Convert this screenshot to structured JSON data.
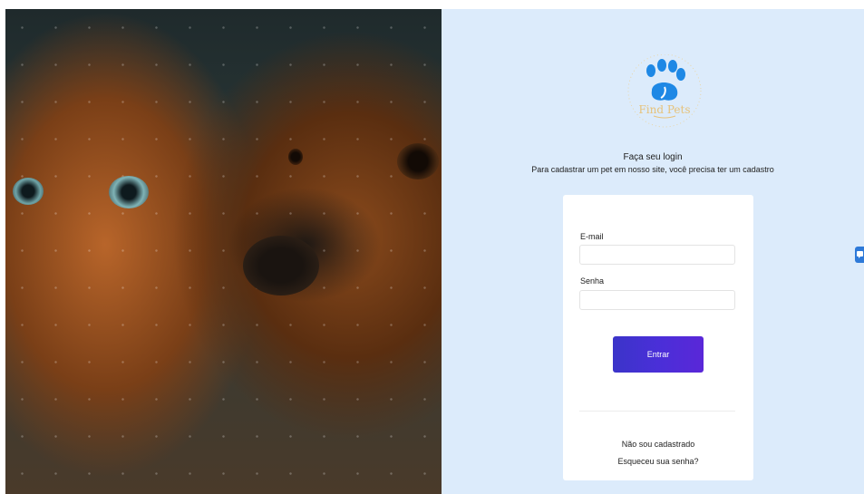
{
  "brand": {
    "name": "Find Pets"
  },
  "login": {
    "title": "Faça seu login",
    "subtitle": "Para cadastrar um pet em nosso site, você precisa ter um cadastro"
  },
  "form": {
    "email_label": "E-mail",
    "email_value": "",
    "password_label": "Senha",
    "password_value": "",
    "submit_label": "Entrar"
  },
  "links": {
    "register": "Não sou cadastrado",
    "forgot_password": "Esqueceu sua senha?"
  },
  "colors": {
    "panel_background": "#dcebfb",
    "button_start": "#3b34c9",
    "button_end": "#5a27d8",
    "logo_blue": "#1e88e5"
  }
}
